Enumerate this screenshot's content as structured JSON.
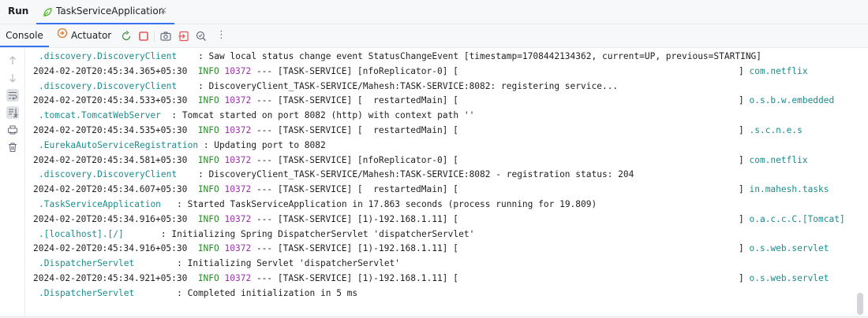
{
  "tabbar": {
    "run_label": "Run",
    "tab_label": "TaskServiceApplication",
    "tab_close": "×",
    "tab_icon": "spring-leaf-icon"
  },
  "toolbar": {
    "console_label": "Console",
    "actuator_label": "Actuator",
    "icons": [
      "rerun-icon",
      "stop-icon",
      "camera-icon",
      "import-icon",
      "search-settings-icon",
      "more-icon"
    ],
    "more_label": "⋮"
  },
  "gutter": {
    "icons": [
      "scroll-up-icon",
      "scroll-down-icon",
      "soft-wrap-icon",
      "scroll-to-end-icon",
      "print-icon",
      "clear-icon"
    ]
  },
  "colors": {
    "class_teal": "#1b8c8c",
    "info_green": "#2d8a2d",
    "pid_purple": "#9a35a8",
    "accent_blue": "#3574f0",
    "stop_red": "#e55353"
  },
  "console": {
    "lines": [
      {
        "cls": ".discovery.DiscoveryClient",
        "msg": "    : Saw local status change event StatusChangeEvent [timestamp=1708442134362, current=UP, previous=STARTING]"
      },
      {
        "ts": "2024-02-20T20:45:34.365+05:30",
        "level": "INFO",
        "pid": "10372",
        "thread": " --- [TASK-SERVICE] [nfoReplicator-0] [",
        "logger": "] com.netflix"
      },
      {
        "cls": ".discovery.DiscoveryClient",
        "msg": "    : DiscoveryClient_TASK-SERVICE/Mahesh:TASK-SERVICE:8082: registering service..."
      },
      {
        "ts": "2024-02-20T20:45:34.533+05:30",
        "level": "INFO",
        "pid": "10372",
        "thread": " --- [TASK-SERVICE] [  restartedMain] [",
        "logger": "] o.s.b.w.embedded"
      },
      {
        "cls": ".tomcat.TomcatWebServer",
        "msg": "  : Tomcat started on port 8082 (http) with context path ''"
      },
      {
        "ts": "2024-02-20T20:45:34.535+05:30",
        "level": "INFO",
        "pid": "10372",
        "thread": " --- [TASK-SERVICE] [  restartedMain] [",
        "logger": "] .s.c.n.e.s"
      },
      {
        "cls": ".EurekaAutoServiceRegistration",
        "msg": " : Updating port to 8082"
      },
      {
        "ts": "2024-02-20T20:45:34.581+05:30",
        "level": "INFO",
        "pid": "10372",
        "thread": " --- [TASK-SERVICE] [nfoReplicator-0] [",
        "logger": "] com.netflix"
      },
      {
        "cls": ".discovery.DiscoveryClient",
        "msg": "    : DiscoveryClient_TASK-SERVICE/Mahesh:TASK-SERVICE:8082 - registration status: 204"
      },
      {
        "ts": "2024-02-20T20:45:34.607+05:30",
        "level": "INFO",
        "pid": "10372",
        "thread": " --- [TASK-SERVICE] [  restartedMain] [",
        "logger": "] in.mahesh.tasks"
      },
      {
        "cls": ".TaskServiceApplication",
        "msg": "   : Started TaskServiceApplication in 17.863 seconds (process running for 19.809)"
      },
      {
        "ts": "2024-02-20T20:45:34.916+05:30",
        "level": "INFO",
        "pid": "10372",
        "thread": " --- [TASK-SERVICE] [1)-192.168.1.11] [",
        "logger": "] o.a.c.c.C.[Tomcat]"
      },
      {
        "cls": ".[localhost].[/]",
        "msg": "       : Initializing Spring DispatcherServlet 'dispatcherServlet'"
      },
      {
        "ts": "2024-02-20T20:45:34.916+05:30",
        "level": "INFO",
        "pid": "10372",
        "thread": " --- [TASK-SERVICE] [1)-192.168.1.11] [",
        "logger": "] o.s.web.servlet"
      },
      {
        "cls": ".DispatcherServlet",
        "msg": "        : Initializing Servlet 'dispatcherServlet'"
      },
      {
        "ts": "2024-02-20T20:45:34.921+05:30",
        "level": "INFO",
        "pid": "10372",
        "thread": " --- [TASK-SERVICE] [1)-192.168.1.11] [",
        "logger": "] o.s.web.servlet"
      },
      {
        "cls": ".DispatcherServlet",
        "msg": "        : Completed initialization in 5 ms"
      }
    ]
  }
}
